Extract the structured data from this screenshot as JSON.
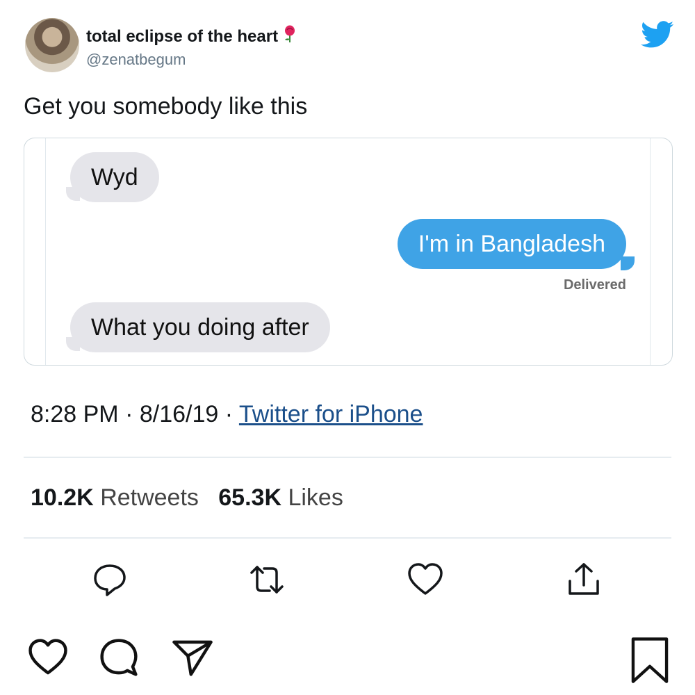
{
  "header": {
    "display_name": "total eclipse of the heart",
    "handle": "@zenatbegum",
    "rose_icon": "rose-icon",
    "brand_icon": "twitter-bird-icon",
    "brand_color": "#1da1f2"
  },
  "tweet": {
    "text": "Get you somebody like this"
  },
  "media": {
    "messages": [
      {
        "side": "incoming",
        "text": "Wyd"
      },
      {
        "side": "outgoing",
        "text": "I'm in Bangladesh"
      },
      {
        "side": "incoming",
        "text": "What you doing after"
      }
    ],
    "delivered_label": "Delivered",
    "incoming_color": "#e5e5ea",
    "outgoing_color": "#3fa3e6"
  },
  "meta": {
    "time": "8:28 PM",
    "date": "8/16/19",
    "separator": " · ",
    "source": "Twitter for iPhone"
  },
  "stats": {
    "retweets_count": "10.2K",
    "retweets_label": "Retweets",
    "likes_count": "65.3K",
    "likes_label": "Likes"
  },
  "tweet_actions": [
    "reply-icon",
    "retweet-icon",
    "like-icon",
    "share-icon"
  ],
  "instagram_actions": [
    "heart-icon",
    "comment-icon",
    "send-icon",
    "bookmark-icon"
  ]
}
